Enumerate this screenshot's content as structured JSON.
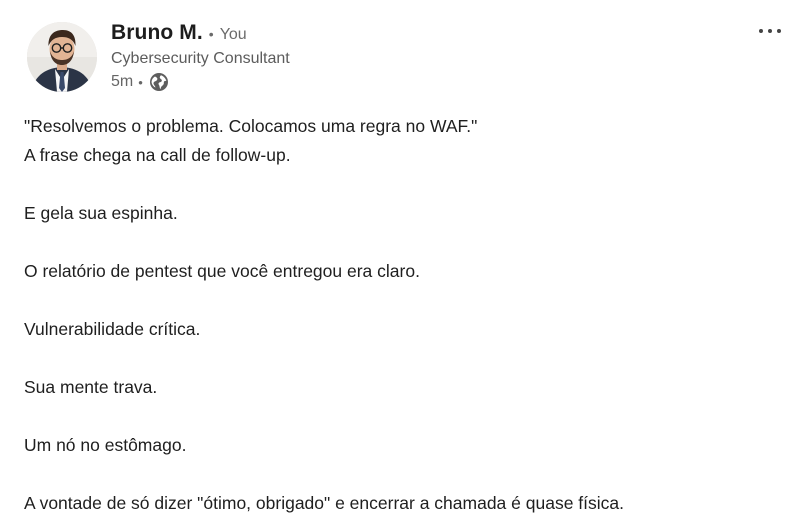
{
  "post": {
    "author": {
      "name": "Bruno M.",
      "relation": "You",
      "separator": "•",
      "headline": "Cybersecurity Consultant",
      "avatar": "avatar-photo"
    },
    "meta": {
      "time": "5m",
      "separator": "•",
      "visibility_icon": "globe-icon"
    },
    "menu_icon": "more-options-icon",
    "lines": [
      "\"Resolvemos o problema. Colocamos uma regra no WAF.\"",
      "A frase chega na call de follow-up.",
      "E gela sua espinha.",
      "O relatório de pentest que você entregou era claro.",
      "Vulnerabilidade crítica.",
      "Sua mente trava.",
      "Um nó no estômago.",
      "A vontade de só dizer \"ótimo, obrigado\" e encerrar a chamada é quase física."
    ]
  }
}
